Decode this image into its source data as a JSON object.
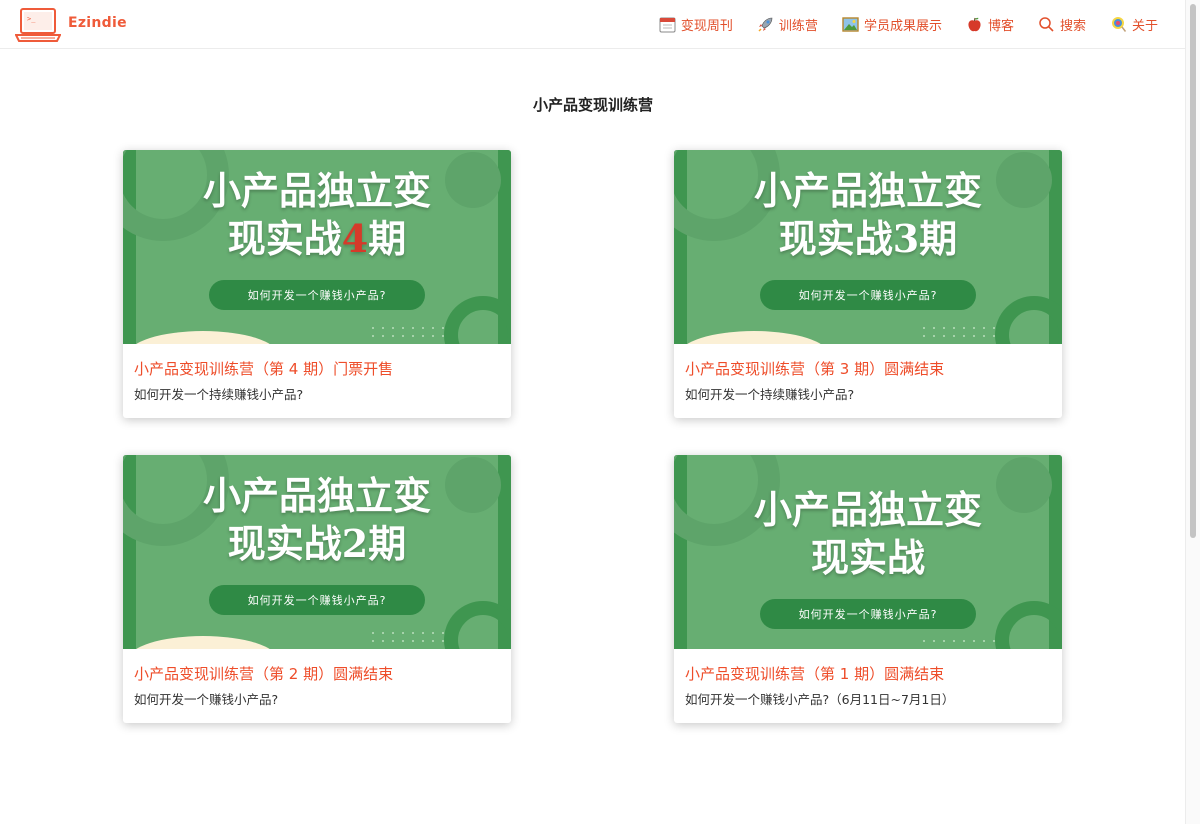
{
  "header": {
    "brand": "Ezindie",
    "nav": [
      {
        "label": "变现周刊",
        "icon": "calendar-icon"
      },
      {
        "label": "训练营",
        "icon": "rocket-icon"
      },
      {
        "label": "学员成果展示",
        "icon": "picture-icon"
      },
      {
        "label": "博客",
        "icon": "apple-icon"
      },
      {
        "label": "搜索",
        "icon": "search-icon"
      },
      {
        "label": "关于",
        "icon": "lollipop-icon"
      }
    ]
  },
  "page": {
    "title": "小产品变现训练营"
  },
  "cards": [
    {
      "banner_line1": "小产品独立变",
      "banner_line2_prefix": "现实战",
      "banner_line2_accent": "4",
      "banner_line2_suffix": "期",
      "banner_pill": "如何开发一个赚钱小产品?",
      "title": "小产品变现训练营（第 4 期）门票开售",
      "desc": "如何开发一个持续赚钱小产品?"
    },
    {
      "banner_line1": "小产品独立变",
      "banner_line2_prefix": "现实战3期",
      "banner_line2_accent": "",
      "banner_line2_suffix": "",
      "banner_pill": "如何开发一个赚钱小产品?",
      "title": "小产品变现训练营（第 3 期）圆满结束",
      "desc": "如何开发一个持续赚钱小产品?"
    },
    {
      "banner_line1": "小产品独立变",
      "banner_line2_prefix": "现实战2期",
      "banner_line2_accent": "",
      "banner_line2_suffix": "",
      "banner_pill": "如何开发一个赚钱小产品?",
      "title": "小产品变现训练营（第 2 期）圆满结束",
      "desc": "如何开发一个赚钱小产品?"
    },
    {
      "banner_line1": "小产品独立变",
      "banner_line2_prefix": "现实战",
      "banner_line2_accent": "",
      "banner_line2_suffix": "",
      "banner_pill": "如何开发一个赚钱小产品?",
      "title": "小产品变现训练营（第 1 期）圆满结束",
      "desc": "如何开发一个赚钱小产品?（6月11日~7月1日）"
    }
  ],
  "colors": {
    "accent": "#ee4d2a",
    "banner_green": "#67ae72",
    "pill_green": "#2f8a45"
  }
}
